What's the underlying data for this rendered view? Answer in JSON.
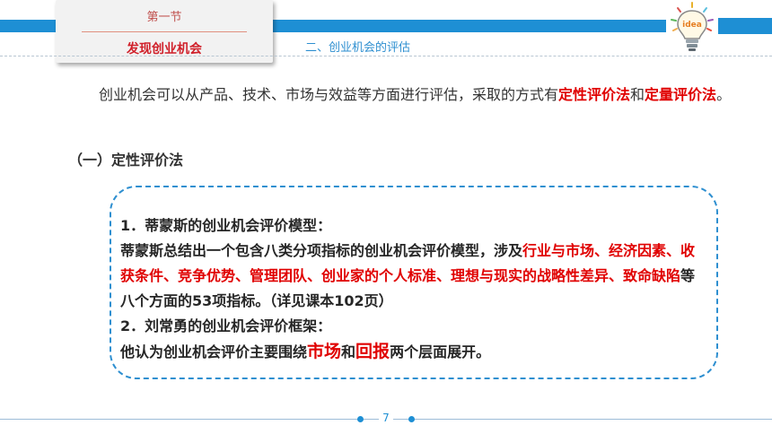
{
  "header": {
    "section_label": "第一节",
    "section_title": "发现创业机会",
    "subtitle": "二、创业机会的评估",
    "bulb_word": "idea"
  },
  "intro": {
    "part1": "创业机会可以从产品、技术、市场与效益等方面进行评估，采取的方式有",
    "method1": "定性评价法",
    "part2": "和",
    "method2": "定量评价法",
    "part3": "。"
  },
  "heading": "（一）定性评价法",
  "callout": {
    "item1_title": "1．蒂蒙斯的创业机会评价模型：",
    "item1_text_a": "蒂蒙斯总结出一个包含八类分项指标的创业机会评价模型，涉及",
    "item1_highlight": "行业与市场、经济因素、收获条件、竞争优势、管理团队、创业家的个人标准、理想与现实的战略性差异、致命缺陷",
    "item1_text_b": "等八个方面的53项指标。（详见课本102页）",
    "item2_title": "2．刘常勇的创业机会评价框架：",
    "item2_text_a": "他认为创业机会评价主要围绕",
    "item2_kw1": "市场",
    "item2_text_b": "和",
    "item2_kw2": "回报",
    "item2_text_c": "两个层面展开。"
  },
  "footer": {
    "page_number": "7"
  },
  "colors": {
    "accent_blue": "#1e8fd4",
    "highlight_red": "#e00000"
  }
}
